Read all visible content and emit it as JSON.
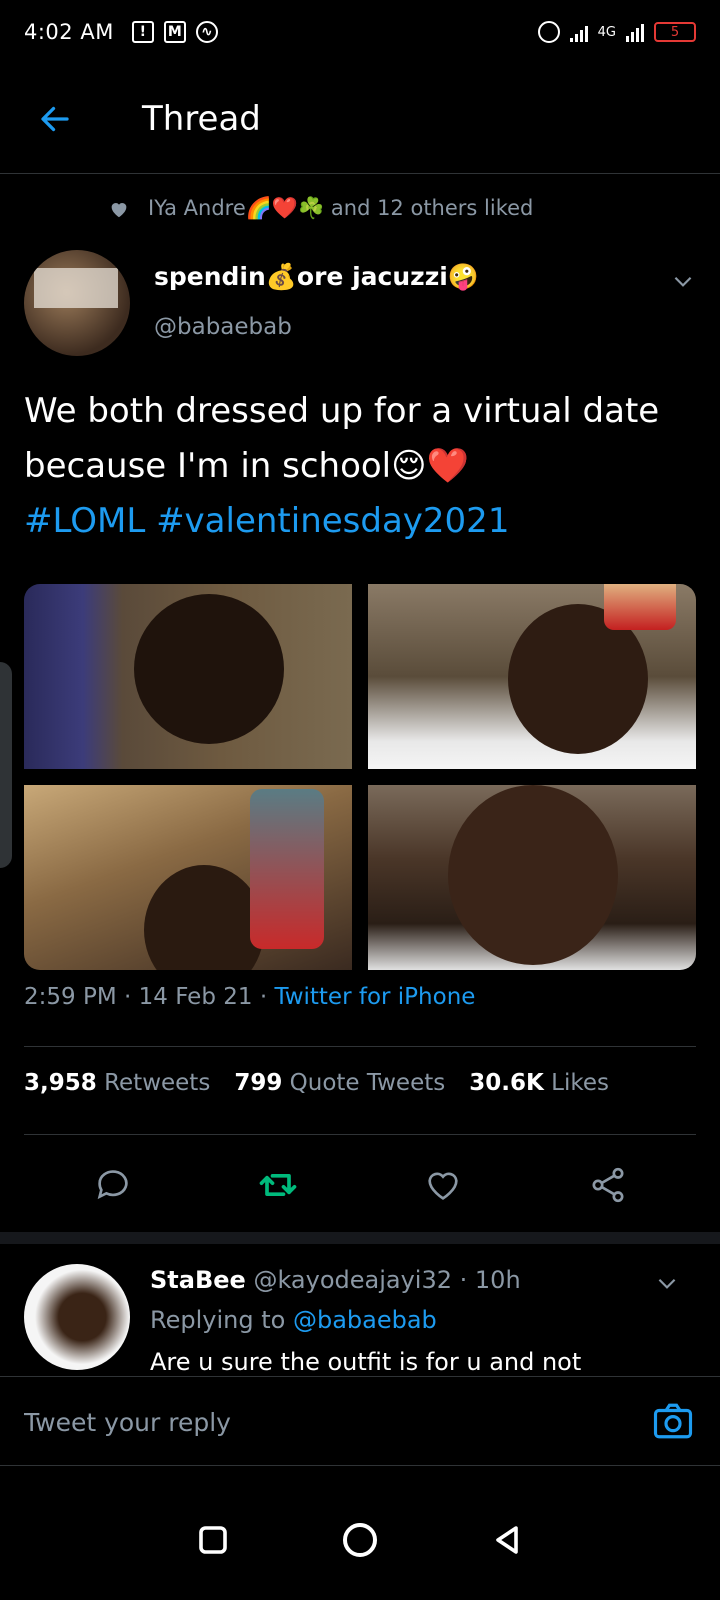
{
  "status_bar": {
    "time": "4:02 AM",
    "network": "4G",
    "battery": "5"
  },
  "header": {
    "title": "Thread"
  },
  "liked_by": {
    "text": "IYa Andre🌈❤️☘️ and 12 others liked"
  },
  "author": {
    "name": "spendin💰ore jacuzzi🤪",
    "handle": "@babaebab"
  },
  "tweet": {
    "text": "We both dressed up for a virtual date because I'm in school😌❤️",
    "hashtags": "#LOML #valentinesday2021"
  },
  "meta": {
    "time": "2:59 PM",
    "date": "14 Feb 21",
    "source": "Twitter for iPhone"
  },
  "stats": {
    "retweets_count": "3,958",
    "retweets_label": "Retweets",
    "quotes_count": "799",
    "quotes_label": "Quote Tweets",
    "likes_count": "30.6K",
    "likes_label": "Likes"
  },
  "colors": {
    "accent": "#1d9bf0",
    "retweet_active": "#00ba7c",
    "background": "#000000",
    "muted": "#8b98a5"
  },
  "icons": [
    "back-arrow-icon",
    "heart-icon",
    "chevron-down-icon",
    "reply-icon",
    "retweet-icon",
    "like-icon",
    "share-icon",
    "camera-icon"
  ],
  "reply": {
    "name": "StaBee",
    "handle": "@kayodeajayi32",
    "time": "10h",
    "replying_prefix": "Replying to",
    "replying_to": "@babaebab",
    "text": "Are u sure the outfit is for u and not"
  },
  "reply_bar": {
    "placeholder": "Tweet your reply"
  }
}
